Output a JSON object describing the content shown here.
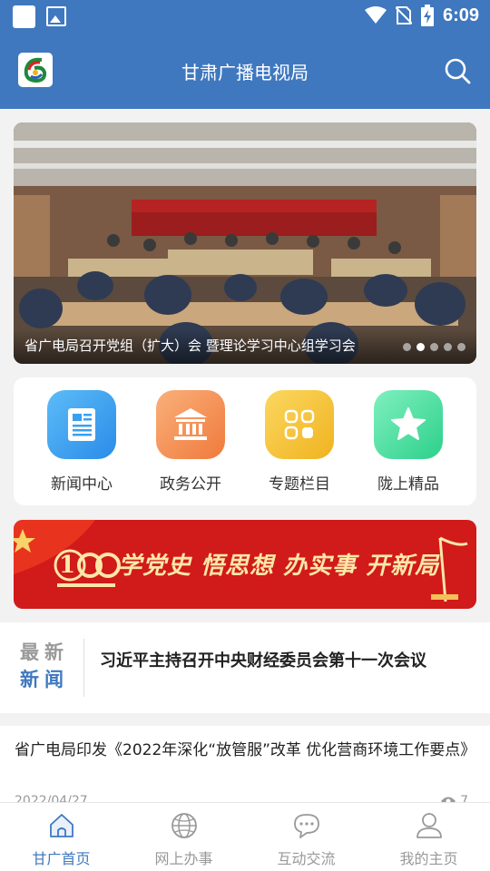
{
  "status_bar": {
    "time": "6:09"
  },
  "header": {
    "title": "甘肃广播电视局"
  },
  "banner": {
    "caption": "省广电局召开党组（扩大）会 暨理论学习中心组学习会",
    "slide_count": 5,
    "active_slide": 2
  },
  "quick_menu": {
    "items": [
      {
        "label": "新闻中心",
        "icon": "newspaper-icon"
      },
      {
        "label": "政务公开",
        "icon": "government-building-icon"
      },
      {
        "label": "专题栏目",
        "icon": "grid-icon"
      },
      {
        "label": "陇上精品",
        "icon": "star-icon"
      }
    ]
  },
  "promo_banner": {
    "slogan": "学党史  悟思想  办实事  开新局"
  },
  "latest_news": {
    "tag_line1": "最新",
    "tag_line2": "新闻",
    "headline": "习近平主持召开中央财经委员会第十一次会议"
  },
  "news_list": [
    {
      "title": "省广电局印发《2022年深化“放管服”改革  优化营商环境工作要点》",
      "date": "2022/04/27",
      "views": "7"
    }
  ],
  "bottom_nav": {
    "items": [
      {
        "label": "甘广首页",
        "icon": "home-icon"
      },
      {
        "label": "网上办事",
        "icon": "globe-icon"
      },
      {
        "label": "互动交流",
        "icon": "chat-icon"
      },
      {
        "label": "我的主页",
        "icon": "user-icon"
      }
    ],
    "active_index": 0
  },
  "colors": {
    "primary": "#3f78bf",
    "news_icon": "#3aa0f0",
    "gov_icon": "#f5904f",
    "topic_icon": "#f6c438",
    "boutique_icon": "#3fd89a",
    "promo_red": "#d11a1a"
  }
}
